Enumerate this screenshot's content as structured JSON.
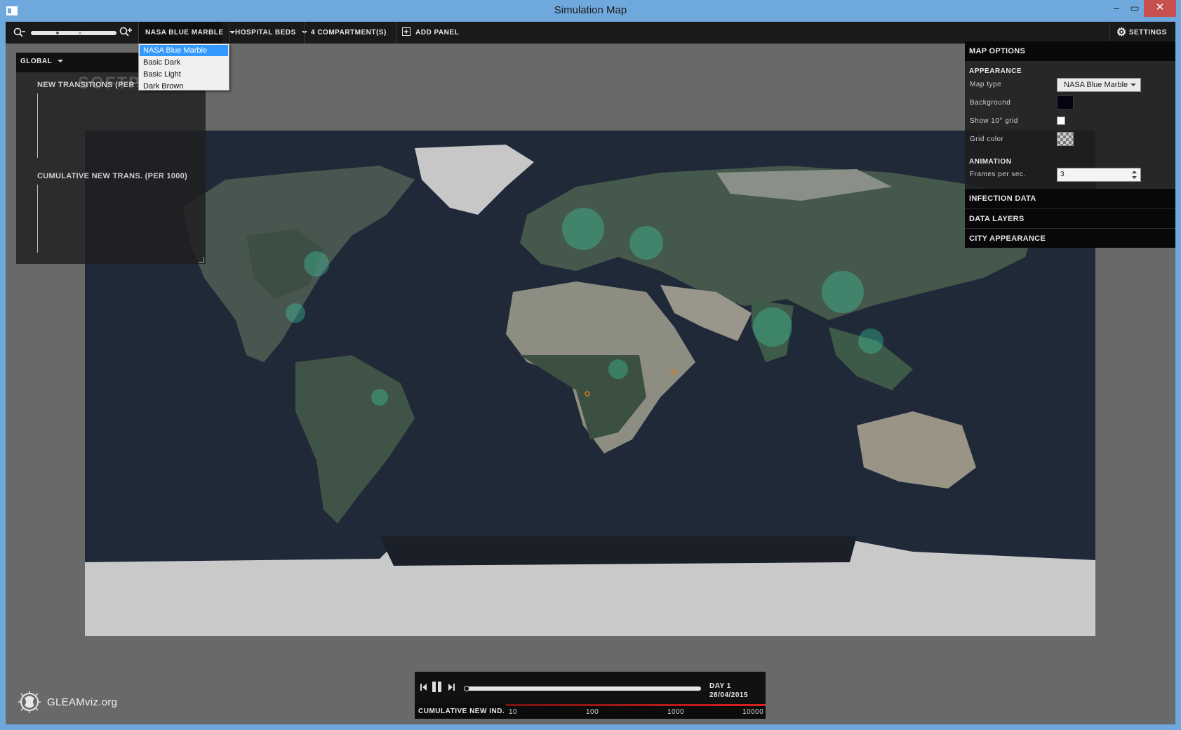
{
  "window": {
    "title": "Simulation Map",
    "minimize": "–",
    "maximize": "▭",
    "close": "✕"
  },
  "toolbar": {
    "zoom_level": 0.5,
    "map_type": "NASA BLUE MARBLE",
    "hospital": "HOSPITAL BEDS",
    "compartments": "4 COMPARTMENT(S)",
    "add_panel": "ADD PANEL",
    "settings": "SETTINGS"
  },
  "map_menu": {
    "items": [
      "NASA Blue Marble",
      "Basic Dark",
      "Basic Light",
      "Dark Brown"
    ],
    "selected_index": 0
  },
  "chart_panel": {
    "scope": "GLOBAL",
    "chart1_title": "NEW TRANSITIONS (PER 1",
    "chart2_title": "CUMULATIVE NEW TRANS. (PER 1000)",
    "watermark": "SOFTPEDIA"
  },
  "settings_panel": {
    "title": "MAP OPTIONS",
    "appearance": "APPEARANCE",
    "map_type_label": "Map type",
    "map_type_value": "NASA Blue Marble",
    "background_label": "Background",
    "background_color": "#050312",
    "grid_label": "Show 10° grid",
    "grid_checked": false,
    "grid_color_label": "Grid color",
    "animation": "ANIMATION",
    "fps_label": "Frames per sec.",
    "fps_value": "3",
    "infection": "INFECTION DATA",
    "layers": "DATA LAYERS",
    "city": "CITY APPEARANCE"
  },
  "timeline": {
    "day": "DAY 1",
    "date": "28/04/2015",
    "progress": 0,
    "legend_label": "CUMULATIVE NEW IND.",
    "ticks": [
      "10",
      "100",
      "1000",
      "10000"
    ]
  },
  "logo": {
    "text": "GLEAMviz.org"
  },
  "colors": {
    "accent": "#3399ff",
    "legend": "#e02020",
    "map_ocean": "#1f2838",
    "map_land": "#3f5046",
    "ice": "#c8c8c8"
  }
}
